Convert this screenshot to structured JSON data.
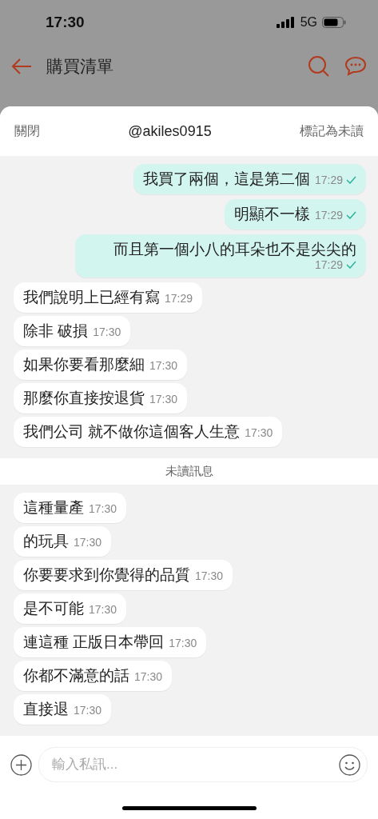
{
  "status_bar": {
    "time": "17:30",
    "network": "5G"
  },
  "header": {
    "title": "購買清單"
  },
  "chat": {
    "close": "關閉",
    "title": "@akiles0915",
    "mark_unread": "標記為未讀"
  },
  "messages": [
    {
      "kind": "sent",
      "text": "我買了兩個，這是第二個",
      "time": "17:29",
      "read": true
    },
    {
      "kind": "sent",
      "text": "明顯不一樣",
      "time": "17:29",
      "read": true
    },
    {
      "kind": "sent",
      "text": "而且第一個小八的耳朵也不是尖尖的",
      "time": "17:29",
      "read": true
    },
    {
      "kind": "received",
      "text": "我們說明上已經有寫",
      "time": "17:29"
    },
    {
      "kind": "received",
      "text": "除非 破損",
      "time": "17:30"
    },
    {
      "kind": "received",
      "text": "如果你要看那麼細",
      "time": "17:30"
    },
    {
      "kind": "received",
      "text": "那麼你直接按退貨",
      "time": "17:30"
    },
    {
      "kind": "received",
      "text": "我們公司 就不做你這個客人生意",
      "time": "17:30"
    },
    {
      "kind": "divider",
      "text": "未讀訊息"
    },
    {
      "kind": "received",
      "text": "這種量產",
      "time": "17:30"
    },
    {
      "kind": "received",
      "text": "的玩具",
      "time": "17:30"
    },
    {
      "kind": "received",
      "text": "你要要求到你覺得的品質",
      "time": "17:30"
    },
    {
      "kind": "received",
      "text": "是不可能",
      "time": "17:30"
    },
    {
      "kind": "received",
      "text": "連這種 正版日本帶回",
      "time": "17:30"
    },
    {
      "kind": "received",
      "text": "你都不滿意的話",
      "time": "17:30"
    },
    {
      "kind": "received",
      "text": "直接退",
      "time": "17:30"
    }
  ],
  "composer": {
    "placeholder": "輸入私訊..."
  }
}
